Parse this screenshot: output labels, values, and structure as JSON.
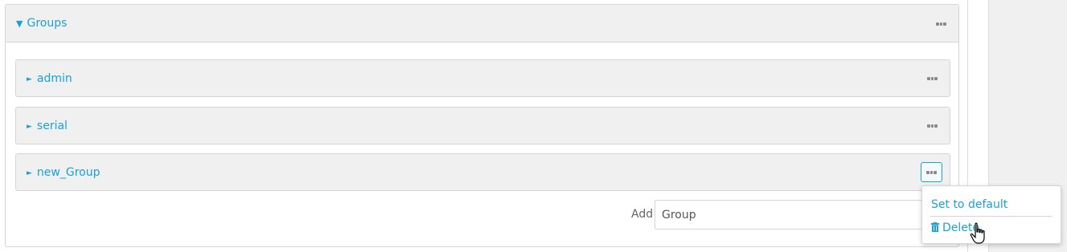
{
  "groups_panel": {
    "title": "Groups",
    "items": [
      {
        "label": "admin"
      },
      {
        "label": "serial"
      },
      {
        "label": "new_Group"
      }
    ]
  },
  "add": {
    "label": "Add",
    "value": "Group"
  },
  "context_menu": {
    "set_default": "Set to default",
    "delete": "Delete"
  },
  "icons": {
    "expand": "triangle-down-icon",
    "collapse": "triangle-right-icon",
    "menu": "ellipsis-icon",
    "delete": "trash-icon",
    "pointer": "hand-cursor-icon"
  },
  "colors": {
    "accent": "#1aa1d6",
    "header_bg": "#f0f0f0",
    "border": "#d5d5d5"
  }
}
